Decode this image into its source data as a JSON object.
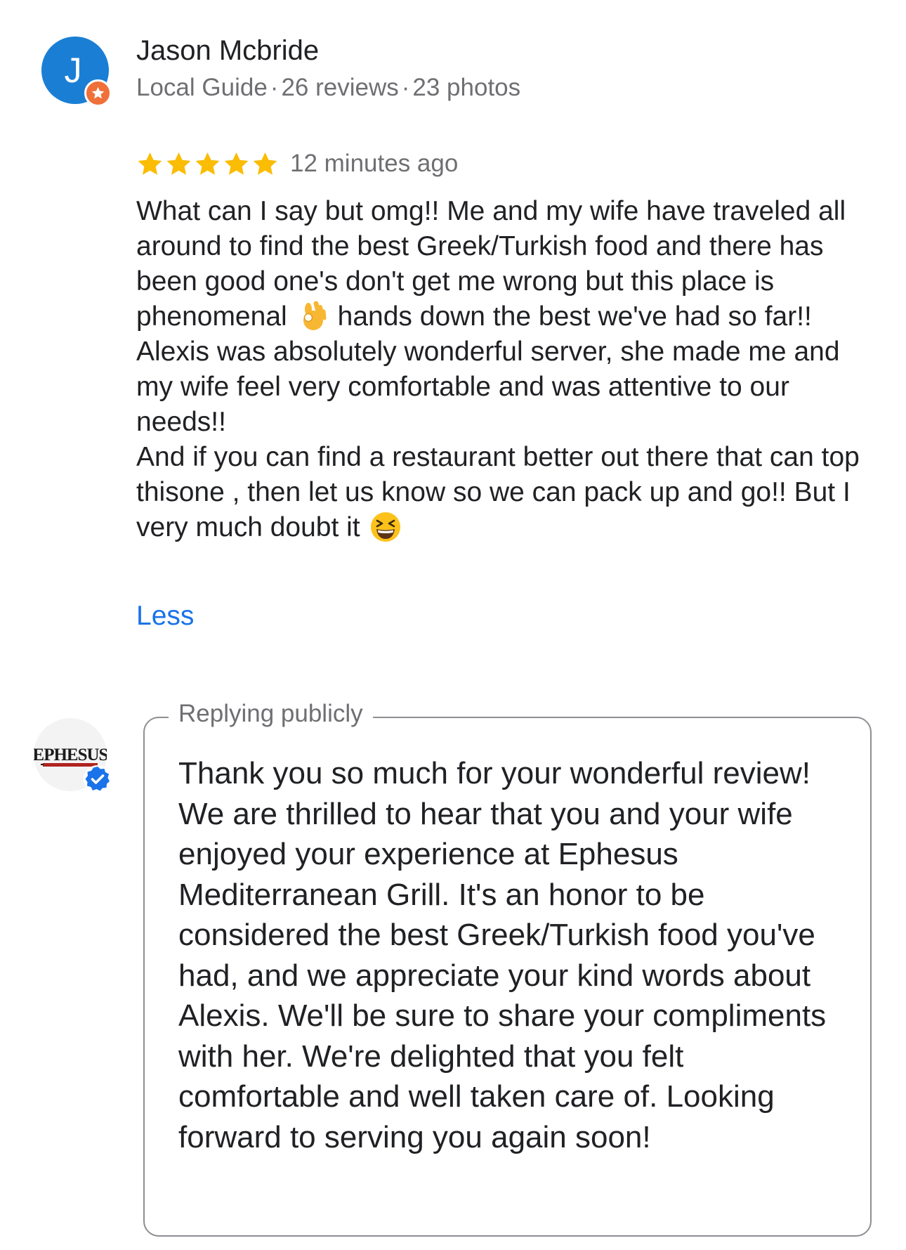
{
  "reviewer": {
    "initial": "J",
    "name": "Jason Mcbride",
    "badge": "Local Guide",
    "reviews": "26 reviews",
    "photos": "23 photos",
    "separator": "·",
    "avatar_color": "#1a7fd4",
    "badge_color": "#f0703a"
  },
  "review": {
    "rating": 5,
    "max_rating": 5,
    "star_color": "#fbbc04",
    "time": "12 minutes ago",
    "text_part1": "What can I say but omg!! Me and my wife have traveled all around to find the best Greek/Turkish food and there has been good one's don't get me wrong but this place is phenomenal",
    "emoji1": "ok-hand-emoji",
    "text_part2": "hands down the best we've had so far!!\nAlexis was absolutely wonderful server, she made me and my wife feel very comfortable and was attentive to our needs!!\nAnd if you can find a restaurant better out there that can top thisone , then let us know so we can pack up and go!! But I very much doubt it",
    "emoji2": "grinning-squinting-face-emoji",
    "less_label": "Less",
    "link_color": "#1a73e8"
  },
  "reply": {
    "legend": "Replying publicly",
    "business_logo": "EPHESUS",
    "text": "Thank you so much for your wonderful review! We are thrilled to hear that you and your wife enjoyed your experience at Ephesus Mediterranean Grill. It's an honor to be considered the best Greek/Turkish food you've had, and we appreciate your kind words about Alexis. We'll be sure to share your compliments with her. We're delighted that you felt comfortable and well taken care of. Looking forward to serving you again soon!",
    "verified_color": "#1a73e8"
  }
}
